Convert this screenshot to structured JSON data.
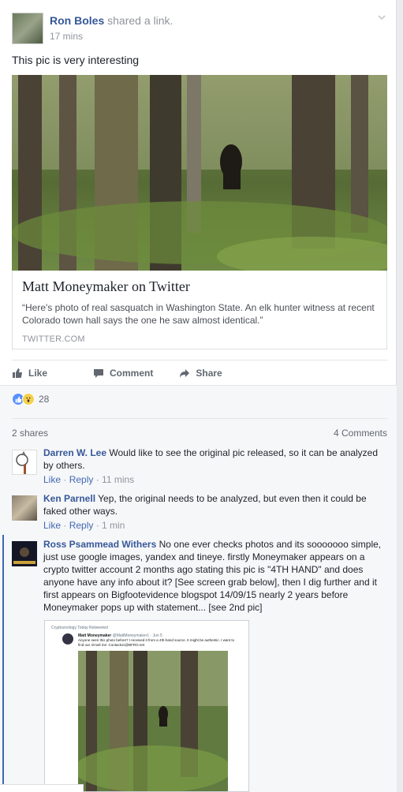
{
  "post": {
    "author": "Ron Boles",
    "action": "shared a",
    "action_link": "link.",
    "time": "17 mins",
    "text": "This pic is very interesting"
  },
  "link": {
    "title": "Matt Moneymaker on Twitter",
    "description": "“Here's photo of real sasquatch in Washington State. An elk hunter witness at recent Colorado town hall says the one he saw almost identical.”",
    "domain": "TWITTER.COM"
  },
  "actions": {
    "like": "Like",
    "comment": "Comment",
    "share": "Share"
  },
  "reactions": {
    "count": "28",
    "icons": [
      "like-icon",
      "wow-icon"
    ]
  },
  "stats": {
    "shares": "2 shares",
    "comments": "4 Comments"
  },
  "comments": [
    {
      "name": "Darren W. Lee",
      "text": "Would like to see the original pic released, so it can be analyzed by others.",
      "like": "Like",
      "reply": "Reply",
      "time": "11 mins"
    },
    {
      "name": "Ken Parnell",
      "text": "Yep, the original needs to be analyzed, but even then it could be faked other ways.",
      "like": "Like",
      "reply": "Reply",
      "time": "1 min"
    },
    {
      "name": "Ross Psammead Withers",
      "text": "No one ever checks photos and its sooooooo simple, just use google images, yandex and tineye. firstly Moneymaker appears on a crypto twitter account 2 months ago stating this pic is \"4TH HAND\" and does anyone have any info about it? [See screen grab below], then I dig further and it first appears on Bigfootevidence blogspot 14/09/15 nearly 2 years before Moneymaker pops up with statement... [see 2nd pic]"
    }
  ],
  "embedded_tweet": {
    "retweet_line": "Cryptozoology Today Retweeted",
    "name": "Matt Moneymaker",
    "handle": "@MattMoneymaker1 · Jun 5",
    "text": "Anyone seen this photo before? I received it from a 4th-hand source. It might be authentic. I want to find out. Email me: ContactUs@BFRO.net"
  },
  "colors": {
    "link_blue": "#365899",
    "meta_gray": "#90949c",
    "like_blue": "#5890ff",
    "wow_yellow": "#f7d14c"
  }
}
